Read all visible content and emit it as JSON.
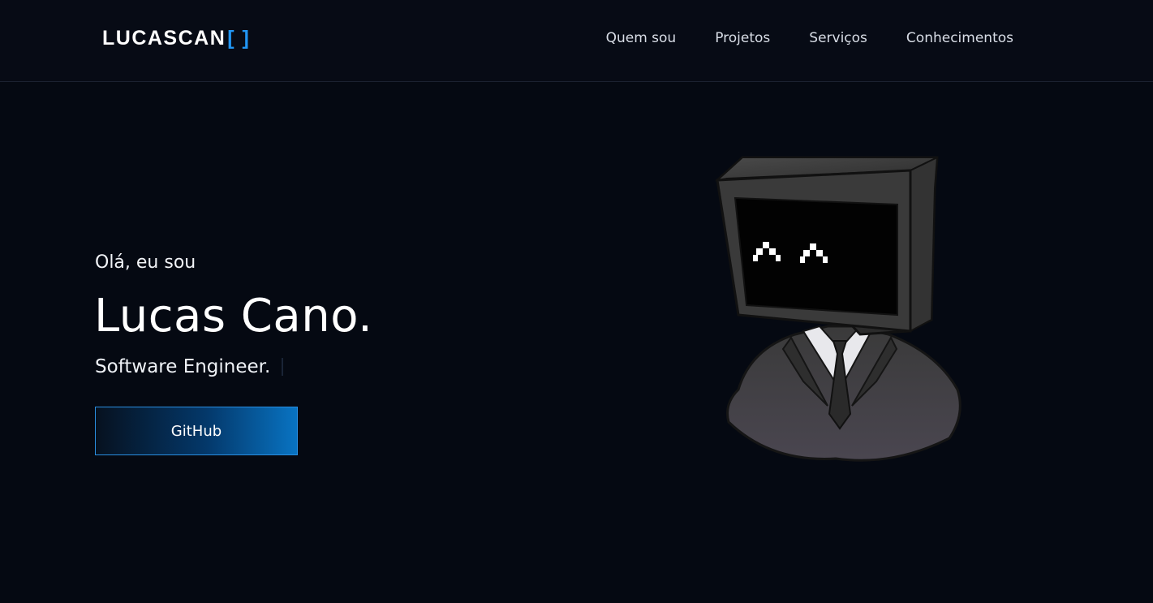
{
  "header": {
    "logo_text": "LUCASCAN",
    "logo_bracket": "[ ]",
    "nav": [
      {
        "label": "Quem sou"
      },
      {
        "label": "Projetos"
      },
      {
        "label": "Serviços"
      },
      {
        "label": "Conhecimentos"
      }
    ]
  },
  "hero": {
    "greeting": "Olá, eu sou",
    "name": "Lucas Cano.",
    "role": "Software Engineer.",
    "cta_label": "GitHub"
  },
  "colors": {
    "background": "#060a12",
    "accent": "#2196f3",
    "button_gradient_end": "#0873c2"
  },
  "icons": {
    "avatar": "monitor-head-suit-illustration"
  }
}
